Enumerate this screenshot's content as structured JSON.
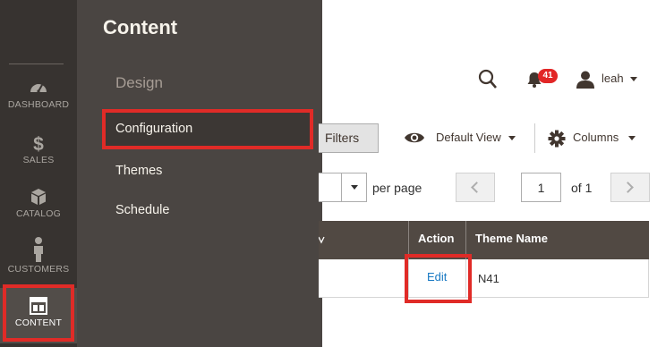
{
  "nav": {
    "items": [
      {
        "label": "DASHBOARD",
        "icon": "speedometer-icon"
      },
      {
        "label": "SALES",
        "icon": "dollar-icon"
      },
      {
        "label": "CATALOG",
        "icon": "box-icon"
      },
      {
        "label": "CUSTOMERS",
        "icon": "person-icon"
      },
      {
        "label": "CONTENT",
        "icon": "layout-icon"
      }
    ],
    "active": "CONTENT"
  },
  "flyout": {
    "title": "Content",
    "group": "Design",
    "items": [
      "Configuration",
      "Themes",
      "Schedule"
    ],
    "selected": "Configuration"
  },
  "header": {
    "notification_count": "41",
    "user_name": "leah"
  },
  "toolbar": {
    "filters_label": "Filters",
    "view_label": "Default View",
    "columns_label": "Columns"
  },
  "pager": {
    "per_page_label": "per page",
    "page": "1",
    "of_label": "of 1"
  },
  "grid": {
    "headers": [
      "Action",
      "Theme Name"
    ],
    "rows": [
      {
        "action": "Edit",
        "theme_name": "N41"
      }
    ]
  },
  "colors": {
    "nav_bg": "#373330",
    "flyout_bg": "#4a4542",
    "highlight": "#e02b27",
    "grid_header": "#514943",
    "link": "#1979c3",
    "badge": "#e22626"
  }
}
